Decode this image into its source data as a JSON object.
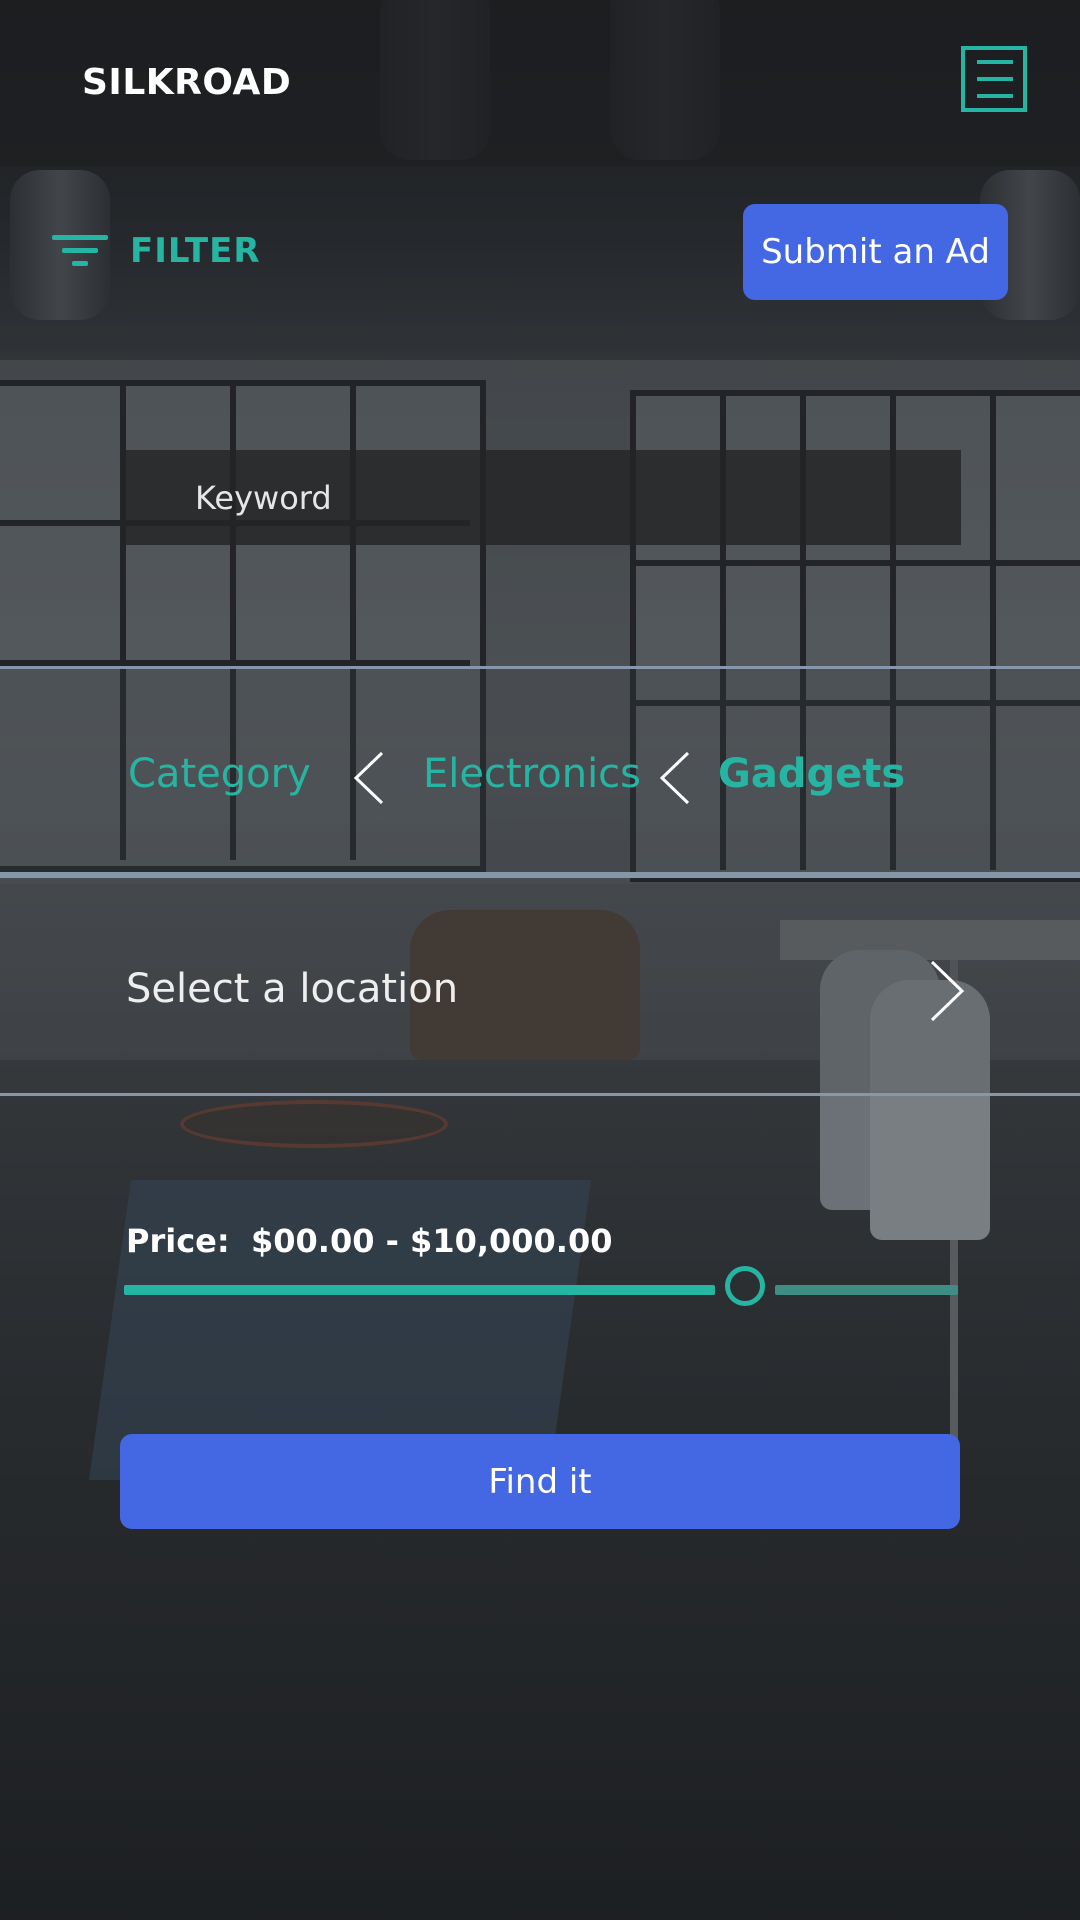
{
  "app": {
    "brand": "SILKROAD"
  },
  "header": {
    "menu_icon": "hamburger-menu-icon"
  },
  "toolbar": {
    "filter_icon": "filter-icon",
    "filter_label": "FILTER",
    "submit_label": "Submit an Ad"
  },
  "search": {
    "keyword_placeholder": "Keyword",
    "keyword_value": ""
  },
  "category": {
    "crumbs": [
      {
        "label": "Category",
        "active": false
      },
      {
        "label": "Electronics",
        "active": false
      },
      {
        "label": "Gadgets",
        "active": true
      }
    ],
    "separator_icon": "chevron-left-icon"
  },
  "location": {
    "label": "Select a location",
    "chevron_icon": "chevron-right-icon"
  },
  "price": {
    "label": "Price:",
    "range_text": "$00.00 - $10,000.00",
    "slider_value_fraction": 0.745
  },
  "actions": {
    "find_label": "Find it"
  },
  "colors": {
    "accent": "#27b5a3",
    "button": "#4468e3",
    "divider": "#8797ab"
  }
}
